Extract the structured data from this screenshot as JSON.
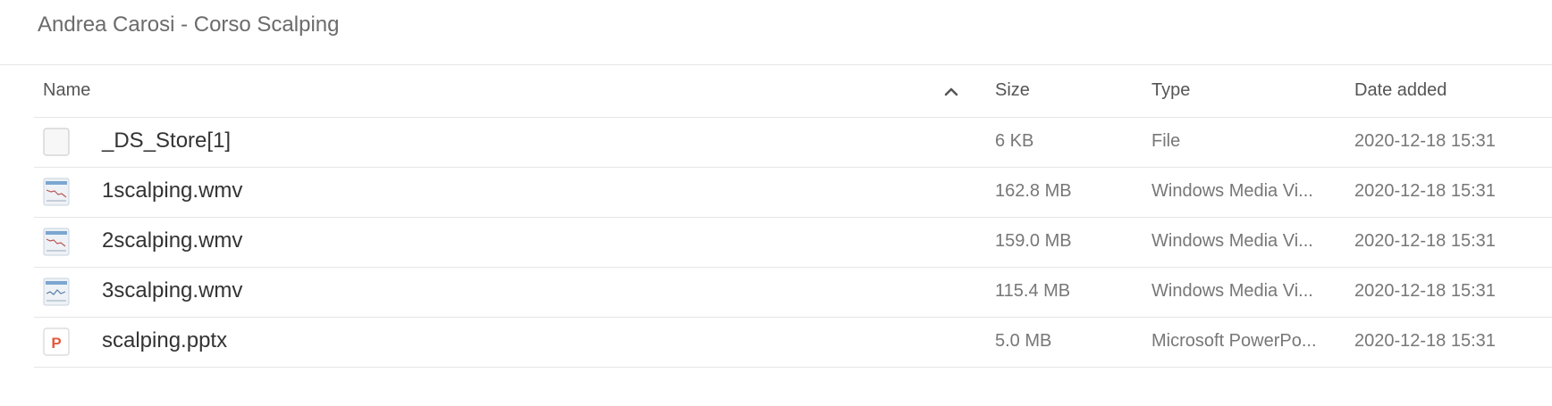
{
  "folder": {
    "title": "Andrea Carosi - Corso Scalping"
  },
  "table": {
    "columns": {
      "name": "Name",
      "size": "Size",
      "type": "Type",
      "date": "Date added"
    },
    "sort_icon": "chevron-up-icon",
    "rows": [
      {
        "name": "_DS_Store[1]",
        "size": "6 KB",
        "type": "File",
        "date": "2020-12-18 15:31",
        "icon": "blank-file-icon"
      },
      {
        "name": "1scalping.wmv",
        "size": "162.8 MB",
        "type": "Windows Media Vi...",
        "date": "2020-12-18 15:31",
        "icon": "video-thumbnail-icon"
      },
      {
        "name": "2scalping.wmv",
        "size": "159.0 MB",
        "type": "Windows Media Vi...",
        "date": "2020-12-18 15:31",
        "icon": "video-thumbnail-icon"
      },
      {
        "name": "3scalping.wmv",
        "size": "115.4 MB",
        "type": "Windows Media Vi...",
        "date": "2020-12-18 15:31",
        "icon": "video-thumbnail-icon"
      },
      {
        "name": "scalping.pptx",
        "size": "5.0 MB",
        "type": "Microsoft PowerPo...",
        "date": "2020-12-18 15:31",
        "icon": "powerpoint-icon"
      }
    ]
  },
  "colors": {
    "accent_powerpoint": "#e35a3c",
    "divider": "#e6e6e6"
  }
}
